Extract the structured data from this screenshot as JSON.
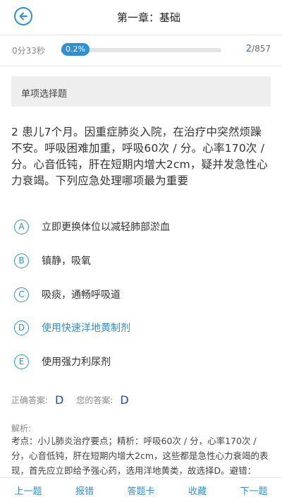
{
  "header": {
    "title": "第一章：基础"
  },
  "progress": {
    "elapsed": "0分33秒",
    "percent_label": "0.2%",
    "fraction": 0.002,
    "current": "2",
    "total": "/857"
  },
  "question": {
    "type_label": "单项选择题",
    "stem": "2  患儿7个月。因重症肺炎入院，在治疗中突然烦躁不安。呼吸困难加重，呼吸60次 / 分。心率170次 / 分。心音低钝，肝在短期内增大2cm，疑并发急性心力衰竭。下列应急处理哪项最为重要",
    "options": [
      {
        "letter": "A",
        "text": "立即更换体位以减轻肺部淤血"
      },
      {
        "letter": "B",
        "text": "镇静，吸氧"
      },
      {
        "letter": "C",
        "text": "吸痰，通畅呼吸道"
      },
      {
        "letter": "D",
        "text": "使用快速洋地黄制剂",
        "selected": true
      },
      {
        "letter": "E",
        "text": "使用强力利尿剂"
      }
    ]
  },
  "answers": {
    "correct_label": "正确答案:",
    "correct_value": "D",
    "yours_label": "您的答案:",
    "yours_value": "D"
  },
  "analysis": {
    "label": "解析:",
    "text": "考点：小儿肺炎治疗要点；精析：呼吸60次 / 分，心率170次 / 分，心音低钝，肝在短期内增大2cm，这些都是急性心力衰竭的表现，首先应立即给予强心药，选用洋地黄类，故选择D。避错："
  },
  "bottom_bar": {
    "prev": "上一题",
    "report": "报错",
    "answer_card": "答题卡",
    "favorite": "收藏",
    "next": "下一题"
  },
  "colors": {
    "accent": "#2e8fd4",
    "answer": "#2a4bb5"
  }
}
